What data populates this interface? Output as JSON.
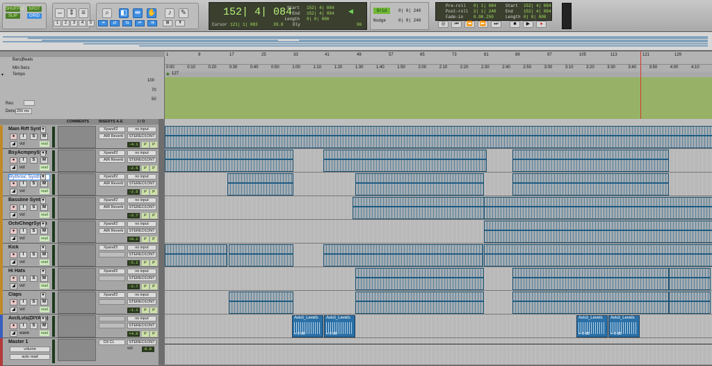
{
  "toolbar": {
    "modes": [
      "SHUFFLE",
      "SPOT",
      "SLIP",
      "GRID"
    ],
    "counter": "152| 4| 084",
    "cursor_label": "Cursor",
    "cursor_value": "121| 1| 083",
    "sample_value": "39.8",
    "dly_label": "Dly",
    "start_label": "Start",
    "start_value": "152| 4| 084",
    "end_label": "End",
    "end_value": "152| 4| 084",
    "length_label": "Length",
    "length_value": "0| 0| 000",
    "grid_label": "Grid",
    "grid_value": "0| 0| 240",
    "nudge_label": "Nudge",
    "nudge_value": "0| 0| 240",
    "preroll_label": "Pre-roll",
    "preroll_value": "0| 1| 084",
    "postroll_label": "Post-roll",
    "postroll_value": "2| 1| 240",
    "fadein_label": "Fade-in",
    "fadein_value": "0.00.250",
    "start2_label": "Start",
    "start2_value": "152| 4| 084",
    "end2_label": "End",
    "end2_value": "152| 4| 084",
    "length2_label": "Length",
    "length2_value": "0| 0| 000",
    "zoom_presets": [
      "1",
      "2",
      "3",
      "4",
      "5"
    ],
    "value_96": "96"
  },
  "rulers": {
    "bars_label": "Bars|Beats",
    "minsecs_label": "Min:Secs",
    "tempo_label": "Tempo",
    "tempo_value": "127",
    "res_label": "Res:",
    "dens_label": "Dens:",
    "dens_value": "250 ms",
    "tempo_axis": [
      "100",
      "70",
      "50"
    ],
    "bars": [
      "1",
      "9",
      "17",
      "25",
      "33",
      "41",
      "49",
      "57",
      "65",
      "73",
      "81",
      "89",
      "97",
      "105",
      "113",
      "121",
      "129"
    ],
    "times": [
      "0:00",
      "0:10",
      "0:20",
      "0:30",
      "0:40",
      "0:50",
      "1:00",
      "1:10",
      "1:20",
      "1:30",
      "1:40",
      "1:50",
      "2:00",
      "2:10",
      "2:20",
      "2:30",
      "2:40",
      "2:50",
      "3:00",
      "3:10",
      "3:20",
      "3:30",
      "3:40",
      "3:50",
      "4:00",
      "4:10"
    ]
  },
  "columns": {
    "comments": "COMMENTS",
    "inserts": "INSERTS A-E",
    "io": "I / O"
  },
  "tracks": [
    {
      "name": "Main Riff Synth",
      "color": "#c08a2a",
      "ins1": "Xpand!2",
      "ins2": "AIR Reverb",
      "in": "no input",
      "out": "STEREO1ONT",
      "vol": "-4.1",
      "read": "read",
      "sel": false,
      "vol_label": "vol"
    },
    {
      "name": "BsyAcmpnySynt",
      "color": "#c08a2a",
      "ins1": "Xpand!2",
      "ins2": "AIR Reverb",
      "in": "no input",
      "out": "STEREO1ONT",
      "vol": "-2.5",
      "read": "read",
      "sel": false,
      "vol_label": "vol"
    },
    {
      "name": "Rythmic Synth",
      "color": "#c08a2a",
      "ins1": "Xpand!2",
      "ins2": "AIR Reverb",
      "in": "no input",
      "out": "STEREO1ONT",
      "vol": "-2.5",
      "read": "read",
      "sel": true,
      "vol_label": "vol"
    },
    {
      "name": "Bassline Synth",
      "color": "#c08a2a",
      "ins1": "Xpand!2",
      "ins2": "AIR Reverb",
      "in": "no input",
      "out": "STEREO1ONT",
      "vol": "-2.7",
      "read": "read",
      "sel": false,
      "vol_label": "vol"
    },
    {
      "name": "OctvChngrSynth",
      "color": "#c08a2a",
      "ins1": "Xpand!2",
      "ins2": "AIR Reverb",
      "in": "no input",
      "out": "STEREO1ONT",
      "vol": "+0.2",
      "read": "read",
      "sel": false,
      "vol_label": "vol"
    },
    {
      "name": "Kick",
      "color": "#c08a2a",
      "ins1": "Xpand!2",
      "ins2": "",
      "in": "no input",
      "out": "STEREO1ONT",
      "vol": "-5.2",
      "read": "read",
      "sel": false,
      "vol_label": "vol"
    },
    {
      "name": "Hi Hats",
      "color": "#c08a2a",
      "ins1": "Xpand!2",
      "ins2": "",
      "in": "no input",
      "out": "STEREO1ONT",
      "vol": "-2.7",
      "read": "read",
      "sel": false,
      "vol_label": "vol"
    },
    {
      "name": "Claps",
      "color": "#c08a2a",
      "ins1": "Xpand!2",
      "ins2": "",
      "in": "no input",
      "out": "STEREO1ONT",
      "vol": "-1.1",
      "read": "read",
      "sel": false,
      "vol_label": "vol"
    },
    {
      "name": "AvclLvls(DIYAcp)",
      "color": "#3a5fc0",
      "ins1": "",
      "ins2": "",
      "in": "no input",
      "out": "STEREO1ONT",
      "vol": "+4.0",
      "read": "read",
      "sel": false,
      "vol_label": "wave"
    }
  ],
  "master": {
    "name": "Master 1",
    "ins1": "D3 CL",
    "out": "STEREO1ONT",
    "vol": "0.0",
    "auto": "volume",
    "auto_read": "auto read",
    "vol_label": "vol"
  },
  "clips": {
    "audio_name": "Avicii_Levels",
    "audio_gain": "+ 0 dB"
  }
}
